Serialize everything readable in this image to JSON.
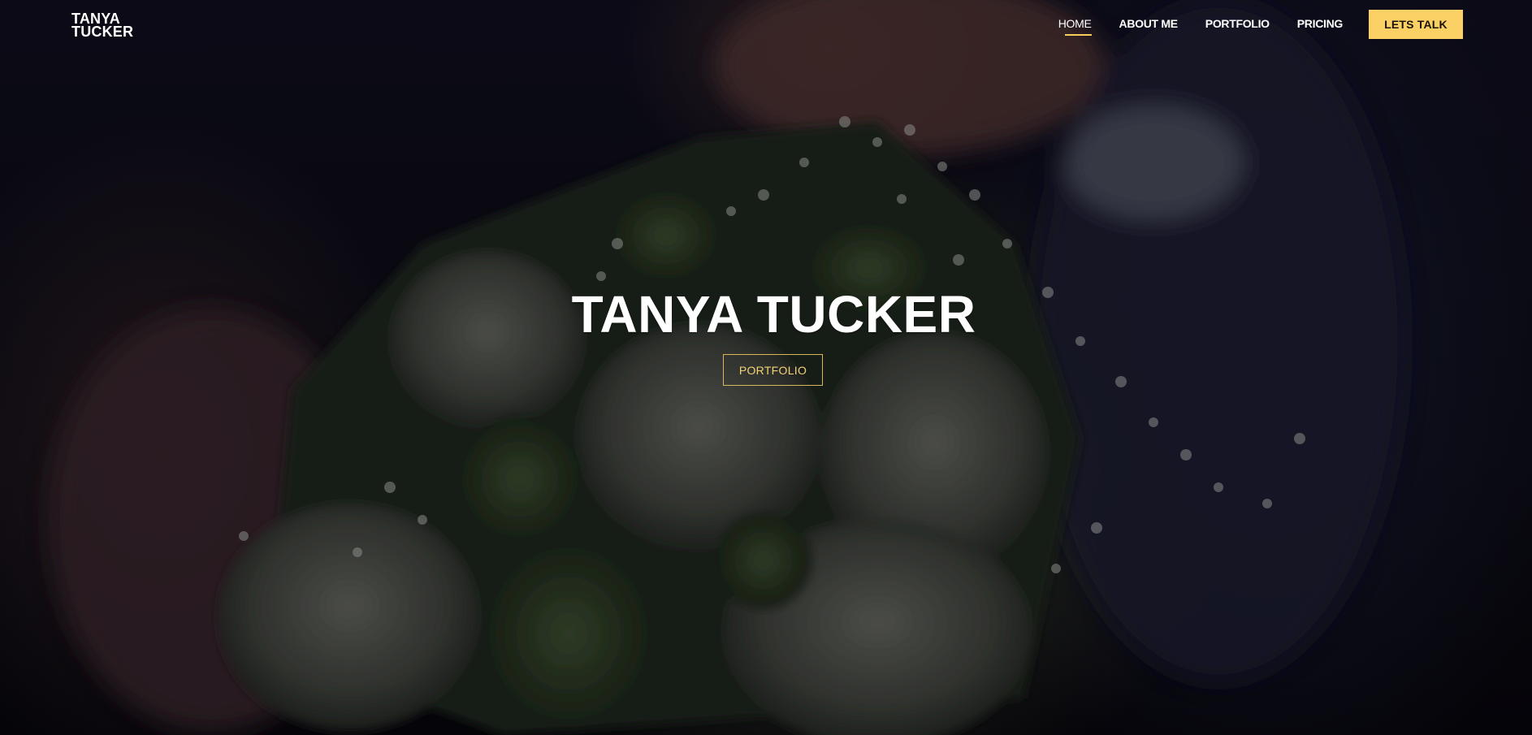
{
  "logo": {
    "line1": "TANYA",
    "line2": "TUCKER"
  },
  "nav": {
    "items": [
      {
        "label": "HOME",
        "active": true
      },
      {
        "label": "ABOUT ME",
        "active": false
      },
      {
        "label": "PORTFOLIO",
        "active": false
      },
      {
        "label": "PRICING",
        "active": false
      }
    ],
    "cta_label": "LETS TALK"
  },
  "hero": {
    "title": "TANYA TUCKER",
    "button_label": "PORTFOLIO"
  },
  "colors": {
    "accent": "#fbd166",
    "outline_button": "#d9b85a",
    "background": "#07060f"
  }
}
